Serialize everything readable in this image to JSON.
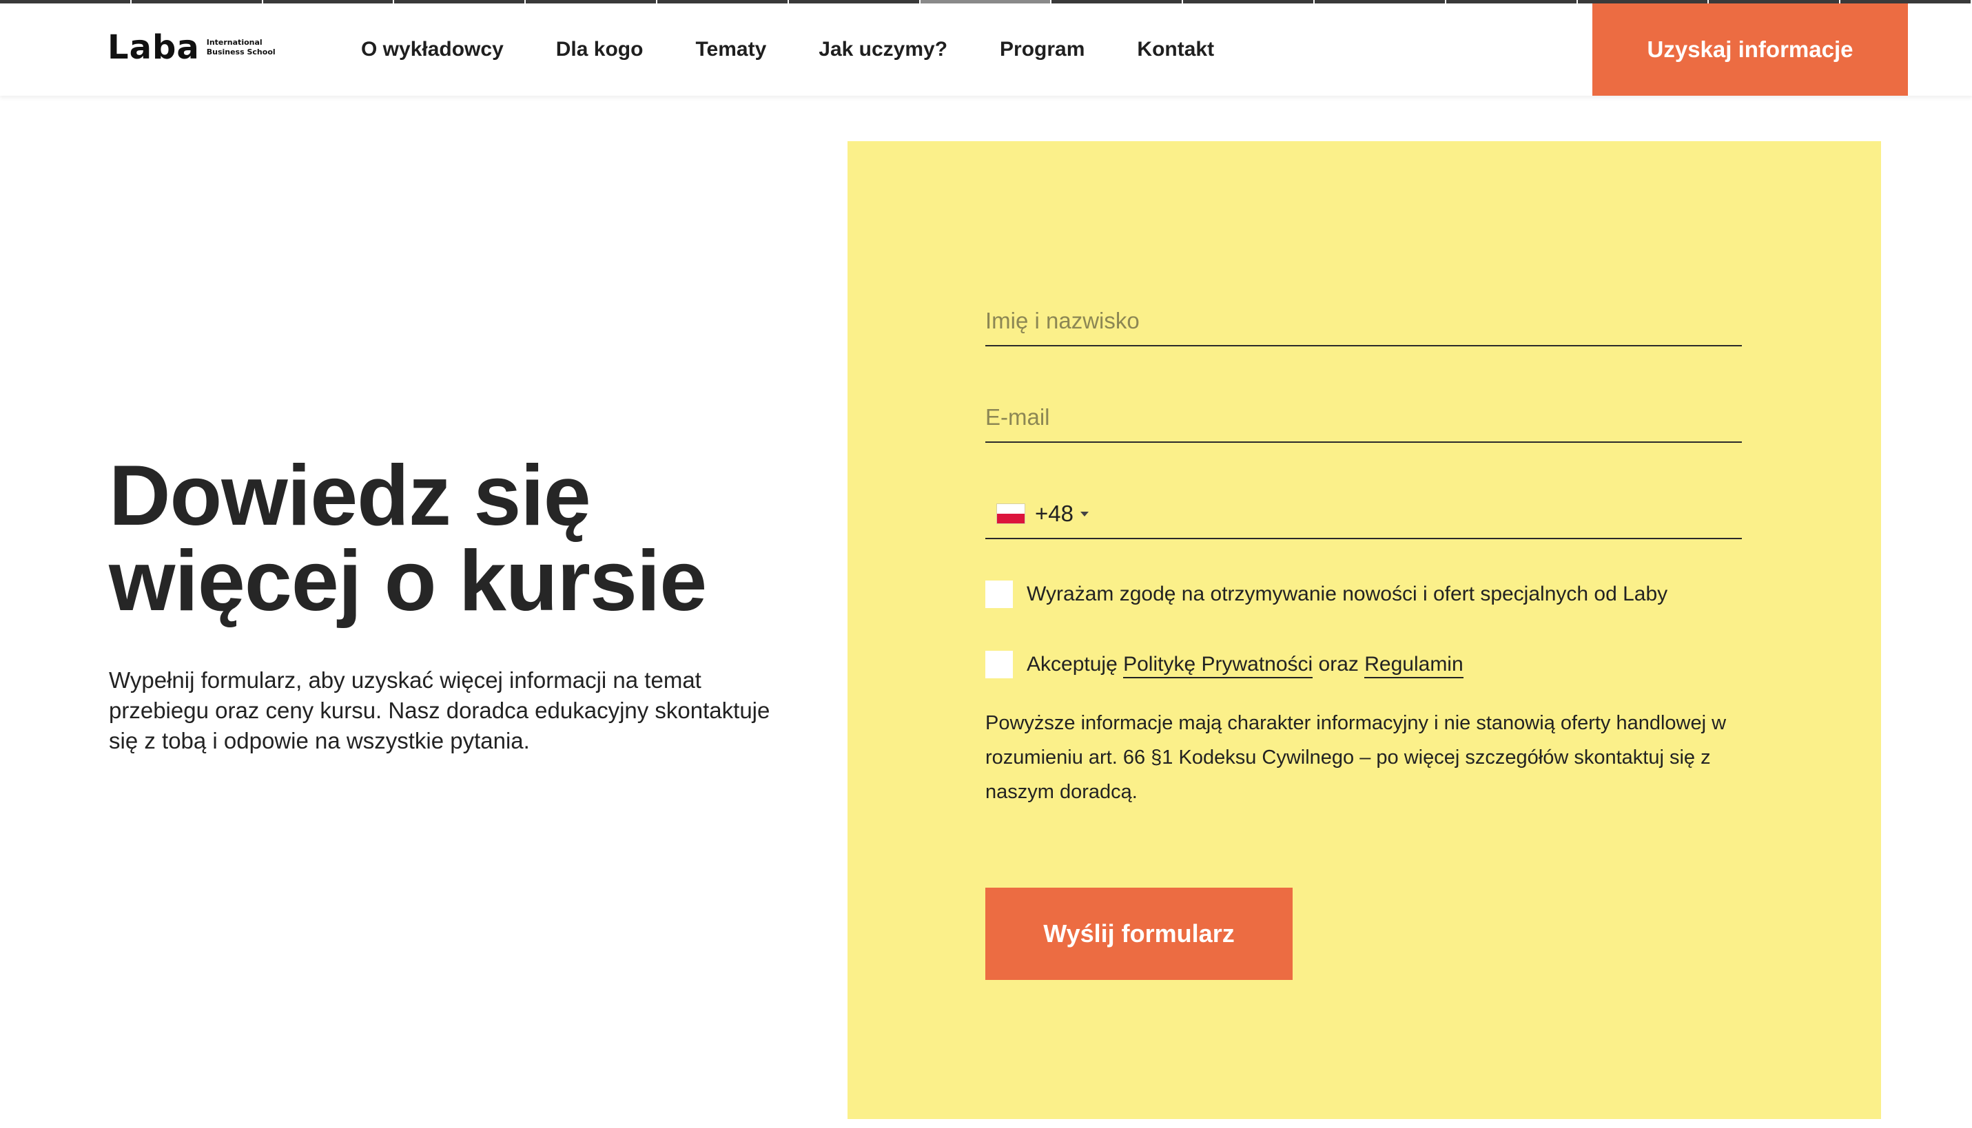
{
  "logo": {
    "name": "Laba",
    "tagline_line1": "International",
    "tagline_line2": "Business School"
  },
  "nav": {
    "items": [
      {
        "label": "O wykładowcy"
      },
      {
        "label": "Dla kogo"
      },
      {
        "label": "Tematy"
      },
      {
        "label": "Jak uczymy?"
      },
      {
        "label": "Program"
      },
      {
        "label": "Kontakt"
      }
    ],
    "cta_label": "Uzyskaj informacje"
  },
  "hero": {
    "title": "Dowiedz się więcej o kursie",
    "description": "Wypełnij formularz, aby uzyskać więcej informacji na temat przebiegu oraz ceny kursu. Nasz doradca edukacyjny skontaktuje się z tobą i odpowie na wszystkie pytania."
  },
  "form": {
    "name_placeholder": "Imię i nazwisko",
    "email_placeholder": "E-mail",
    "phone": {
      "country_flag": "poland-flag",
      "dial_code": "+48",
      "value": ""
    },
    "consent_newsletter": "Wyrażam zgodę na otrzymywanie nowości i ofert specjalnych od Laby",
    "consent_terms": {
      "prefix": "Akceptuję",
      "privacy_link": "Politykę Prywatności",
      "joiner": "oraz",
      "terms_link": "Regulamin"
    },
    "disclaimer": "Powyższe informacje mają charakter informacyjny i nie stanowią oferty handlowej w rozumieniu art. 66 §1 Kodeksu Cywilnego – po więcej szczegółów skontaktuj się z naszym doradcą.",
    "submit_label": "Wyślij formularz"
  },
  "colors": {
    "accent": "#ec6c42",
    "panel": "#fbf08a",
    "text": "#262626"
  }
}
